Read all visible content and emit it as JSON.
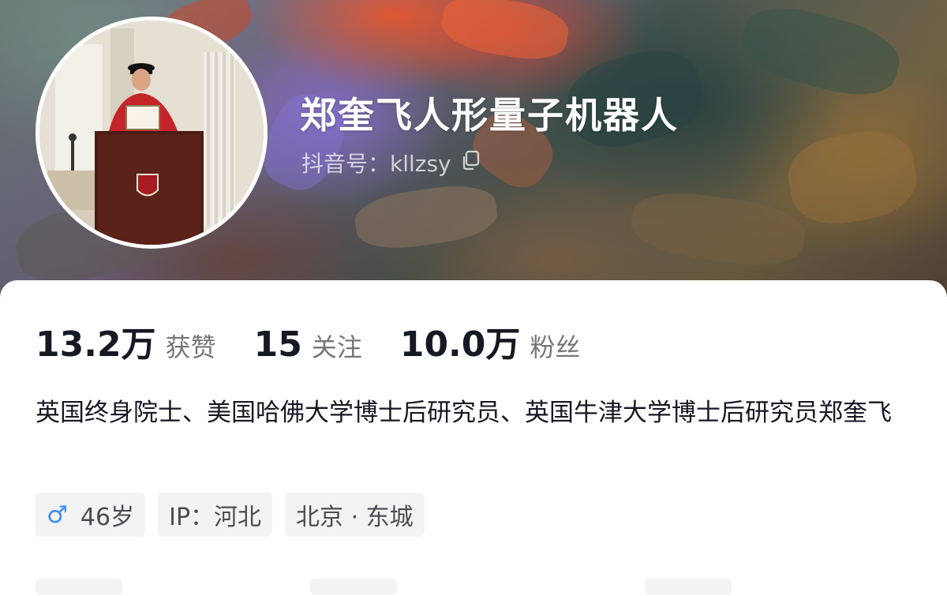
{
  "profile": {
    "name": "郑奎飞人形量子机器人",
    "douyin_id": "抖音号：kllzsy"
  },
  "stats": {
    "likes_value": "13.2万",
    "likes_label": "获赞",
    "following_value": "15",
    "following_label": "关注",
    "followers_value": "10.0万",
    "followers_label": "粉丝"
  },
  "bio": "英国终身院士、美国哈佛大学博士后研究员、英国牛津大学博士后研究员郑奎飞",
  "tags": {
    "gender_icon": "male-icon",
    "age": "46岁",
    "ip": "IP：河北",
    "location": "北京 · 东城"
  },
  "icons": {
    "copy": "copy-icon",
    "gender": "male-icon"
  },
  "colors": {
    "male_blue": "#3a8ef6",
    "text_primary": "#161823",
    "text_secondary": "#75767b",
    "tag_bg": "#f3f3f4"
  }
}
